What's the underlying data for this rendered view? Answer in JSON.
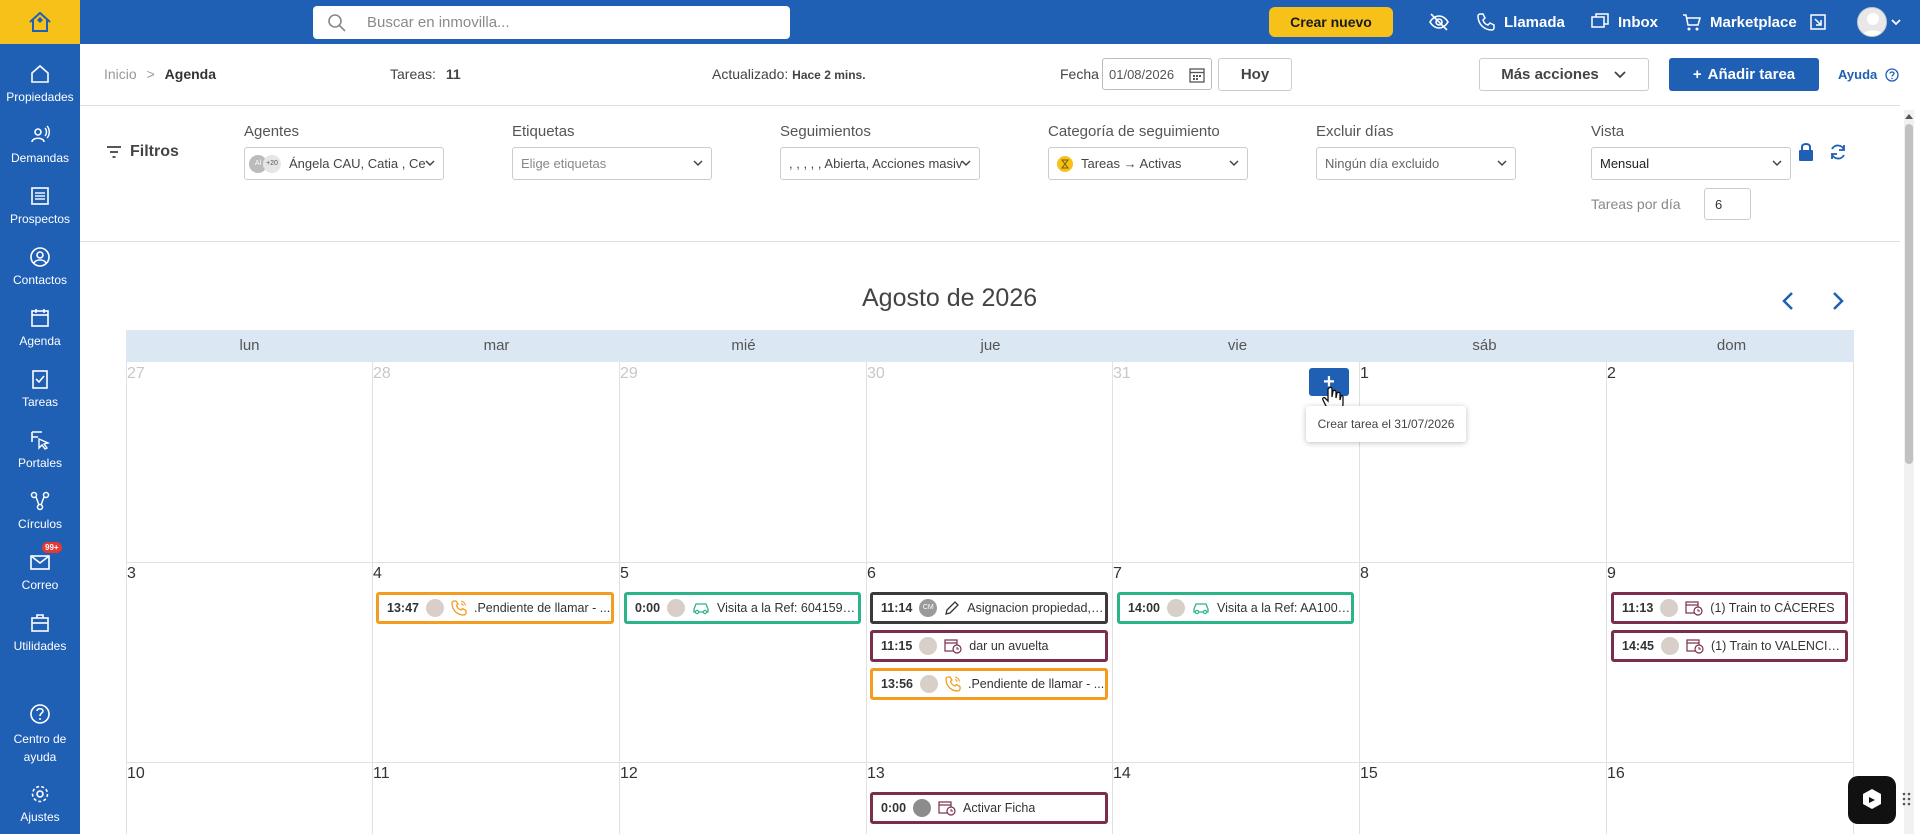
{
  "topbar": {
    "search_placeholder": "Buscar en inmovilla...",
    "create_new": "Crear nuevo",
    "call": "Llamada",
    "inbox": "Inbox",
    "marketplace": "Marketplace"
  },
  "sidebar": {
    "items": [
      {
        "label": "Propiedades"
      },
      {
        "label": "Demandas"
      },
      {
        "label": "Prospectos"
      },
      {
        "label": "Contactos"
      },
      {
        "label": "Agenda"
      },
      {
        "label": "Tareas"
      },
      {
        "label": "Portales"
      },
      {
        "label": "Círculos"
      },
      {
        "label": "Correo",
        "badge": "99+"
      },
      {
        "label": "Utilidades"
      },
      {
        "label": "Centro de ayuda"
      },
      {
        "label": "Ajustes"
      }
    ]
  },
  "header": {
    "breadcrumb_home": "Inicio",
    "breadcrumb_sep": ">",
    "breadcrumb_current": "Agenda",
    "tasks_label": "Tareas:",
    "tasks_count": "11",
    "updated_label": "Actualizado:",
    "updated_value": "Hace 2 mins.",
    "date_label": "Fecha",
    "date_value": "01/08/2026",
    "today": "Hoy",
    "more_actions": "Más acciones",
    "add_task": "Añadir tarea",
    "help": "Ayuda"
  },
  "filters": {
    "title": "Filtros",
    "agents_label": "Agentes",
    "agents_value": "Ángela CAU, Catia , Ce",
    "agents_avatar_text": "Al",
    "agents_extra": "+20",
    "tags_label": "Etiquetas",
    "tags_placeholder": "Elige etiquetas",
    "followups_label": "Seguimientos",
    "followups_value": ", , , , , Abierta, Acciones masiv",
    "category_label": "Categoría de seguimiento",
    "category_value": "Tareas → Activas",
    "exclude_label": "Excluir días",
    "exclude_value": "Ningún día excluido",
    "view_label": "Vista",
    "view_value": "Mensual",
    "tasks_per_day_label": "Tareas por día",
    "tasks_per_day_value": "6"
  },
  "calendar": {
    "month_title": "Agosto de 2026",
    "day_names": [
      "lun",
      "mar",
      "mié",
      "jue",
      "vie",
      "sáb",
      "dom"
    ],
    "weeks": [
      [
        "27",
        "28",
        "29",
        "30",
        "31",
        "1",
        "2"
      ],
      [
        "3",
        "4",
        "5",
        "6",
        "7",
        "8",
        "9"
      ],
      [
        "10",
        "11",
        "12",
        "13",
        "14",
        "15",
        "16"
      ]
    ],
    "tooltip": "Crear tarea el 31/07/2026",
    "tasks": {
      "t1": {
        "time": "13:47",
        "text": ".Pendiente de llamar - ..."
      },
      "t2": {
        "time": "0:00",
        "text": "Visita a la Ref: 6041592..."
      },
      "t3": {
        "time": "11:14",
        "avatar": "CM",
        "text": "Asignacion propiedad, l..."
      },
      "t4": {
        "time": "11:15",
        "text": "dar un avuelta"
      },
      "t5": {
        "time": "13:56",
        "text": ".Pendiente de llamar - ..."
      },
      "t6": {
        "time": "14:00",
        "text": "Visita a la Ref: AA1000..."
      },
      "t7": {
        "time": "11:13",
        "text": "(1) Train to CÁCERES"
      },
      "t8": {
        "time": "14:45",
        "text": "(1) Train to VALENCIA ..."
      },
      "t9": {
        "time": "0:00",
        "text": "Activar Ficha"
      }
    }
  },
  "colors": {
    "brand": "#1f5fb4",
    "accent": "#f6c21a",
    "call_task": "#f39c1f",
    "visit_task": "#2bb38a",
    "note_task": "#3a3a3a",
    "event_task": "#7a2d4c"
  }
}
